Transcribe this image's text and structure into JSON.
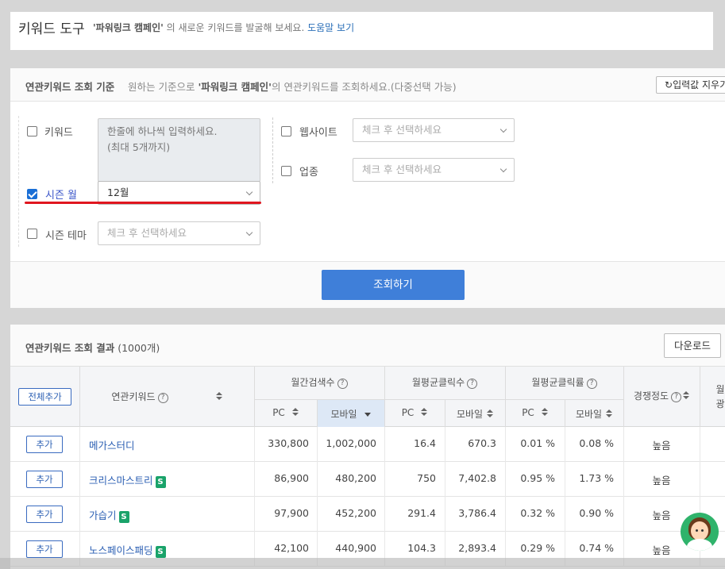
{
  "top": {
    "title": "키워드 도구",
    "desc_campaign": "'파워링크 캠페인'",
    "desc_text": " 의 새로운 키워드를 발굴해 보세요.",
    "help_link": "도움말 보기"
  },
  "criteria": {
    "title": "연관키워드 조회 기준",
    "desc_pre": "원하는 기준으로 ",
    "desc_campaign": "'파워링크 캠페인'",
    "desc_post": "의 연관키워드를 조회하세요.(다중선택 가능)",
    "reset_label": "입력값 지우기",
    "keyword_label": "키워드",
    "keyword_placeholder_line1": "한줄에 하나씩 입력하세요.",
    "keyword_placeholder_line2": "(최대 5개까지)",
    "season_month_label": "시즌 월",
    "season_month_value": "12월",
    "season_theme_label": "시즌 테마",
    "season_theme_placeholder": "체크 후 선택하세요",
    "website_label": "웹사이트",
    "website_placeholder": "체크 후 선택하세요",
    "industry_label": "업종",
    "industry_placeholder": "체크 후 선택하세요",
    "search_button": "조회하기",
    "season_month_checked": true
  },
  "results": {
    "title": "연관키워드 조회 결과",
    "count": " (1000개)",
    "download_label": "다운로드",
    "header": {
      "add_all": "전체추가",
      "keyword": "연관키워드",
      "monthly_search": "월간검색수",
      "monthly_avg_clicks": "월평균클릭수",
      "monthly_avg_ctr": "월평균클릭률",
      "competition": "경쟁정도",
      "pc": "PC",
      "mobile": "모바일",
      "next_col_partial_1": "월",
      "next_col_partial_2": "광"
    },
    "add_label": "추가",
    "badge": "S",
    "rows": [
      {
        "keyword": "메가스터디",
        "badge": false,
        "search_pc": "330,800",
        "search_mobile": "1,002,000",
        "click_pc": "16.4",
        "click_mobile": "670.3",
        "ctr_pc": "0.01 %",
        "ctr_mobile": "0.08 %",
        "competition": "높음"
      },
      {
        "keyword": "크리스마스트리",
        "badge": true,
        "search_pc": "86,900",
        "search_mobile": "480,200",
        "click_pc": "750",
        "click_mobile": "7,402.8",
        "ctr_pc": "0.95 %",
        "ctr_mobile": "1.73 %",
        "competition": "높음"
      },
      {
        "keyword": "가습기",
        "badge": true,
        "search_pc": "97,900",
        "search_mobile": "452,200",
        "click_pc": "291.4",
        "click_mobile": "3,786.4",
        "ctr_pc": "0.32 %",
        "ctr_mobile": "0.90 %",
        "competition": "높음"
      },
      {
        "keyword": "노스페이스패딩",
        "badge": true,
        "search_pc": "42,100",
        "search_mobile": "440,900",
        "click_pc": "104.3",
        "click_mobile": "2,893.4",
        "ctr_pc": "0.29 %",
        "ctr_mobile": "0.74 %",
        "competition": "높음"
      }
    ]
  }
}
